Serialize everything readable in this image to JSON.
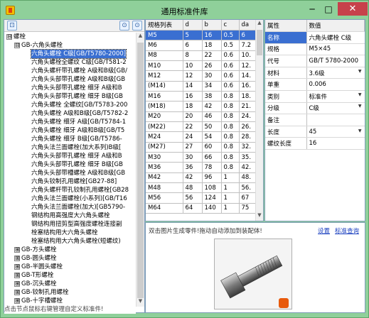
{
  "window": {
    "title": "通用标准件库",
    "minimize": "─",
    "maximize": "□",
    "close": "✕"
  },
  "left_toolbar": {
    "left_btn": "⊡",
    "search_btn": "⊙",
    "search2_btn": "⊙"
  },
  "tree": {
    "root": {
      "expander": "⊟",
      "label": "螺栓"
    },
    "group": {
      "expander": "⊟",
      "label": "GB-六角头螺栓"
    },
    "items": [
      "六角头螺栓 C级[GB/T5780-2000]",
      "六角头螺栓全螺纹 C级[GB/T581-2",
      "六角头螺杆带孔螺栓 A级和B级[GB/",
      "六角头头部带孔螺栓 A级和B级[GB",
      "六角头头部带孔螺栓 细牙 A级和B",
      "六角头头部带孔螺栓 细牙 B级[GB",
      "六角头螺栓 全螺纹[GB/T5783-200",
      "六角头螺栓 A级和B级[GB/T5782-2",
      "六角头螺栓 细牙 A级[GB/T5784-1",
      "六角头螺栓 细牙 A级和B级[GB/T5",
      "六角头螺栓 细牙 B级[GB/T5786-",
      "六角头法兰面螺栓(加大系列)B级[",
      "六角头头部带孔螺栓 细牙 A级和B",
      "六角头头部带孔螺栓 细牙 B级[GB",
      "六角头头部带槽螺栓 A级和B级[GB",
      "六角头铰制孔用螺栓[GB27-88]",
      "六角头螺杆带孔铰制孔用螺栓[GB28",
      "六角头法兰面螺栓(小系列)[GB/T16",
      "六角头法兰面螺栓(加大)[GB5790-",
      "钢结构用高强度大六角头螺栓",
      "钢结构用扭剪型高强度螺栓连接副",
      "栓塞结构用大六角头螺栓",
      "栓塞结构用大六角头螺栓(短螺纹)"
    ],
    "groups": [
      {
        "expander": "⊞",
        "label": "GB-方头螺栓"
      },
      {
        "expander": "⊞",
        "label": "GB-圆头螺栓"
      },
      {
        "expander": "⊞",
        "label": "GB-半圆头螺栓"
      },
      {
        "expander": "⊞",
        "label": "GB-T形螺栓"
      },
      {
        "expander": "⊞",
        "label": "GB-沉头螺栓"
      },
      {
        "expander": "⊞",
        "label": "GB-铰制孔用螺栓"
      },
      {
        "expander": "⊞",
        "label": "GB-十字槽螺栓"
      }
    ],
    "status": "点击节点鼠标右键管理自定义标准件!"
  },
  "spec_table": {
    "columns": [
      "规格列表",
      "d",
      "b",
      "c",
      "da"
    ],
    "rows": [
      [
        "M5",
        "5",
        "16",
        "0.5",
        "6"
      ],
      [
        "M6",
        "6",
        "18",
        "0.5",
        "7.2"
      ],
      [
        "M8",
        "8",
        "22",
        "0.6",
        "10."
      ],
      [
        "M10",
        "10",
        "26",
        "0.6",
        "12."
      ],
      [
        "M12",
        "12",
        "30",
        "0.6",
        "14."
      ],
      [
        "(M14)",
        "14",
        "34",
        "0.6",
        "16."
      ],
      [
        "M16",
        "16",
        "38",
        "0.8",
        "18."
      ],
      [
        "(M18)",
        "18",
        "42",
        "0.8",
        "21."
      ],
      [
        "M20",
        "20",
        "46",
        "0.8",
        "24."
      ],
      [
        "(M22)",
        "22",
        "50",
        "0.8",
        "26."
      ],
      [
        "M24",
        "24",
        "54",
        "0.8",
        "28."
      ],
      [
        "(M27)",
        "27",
        "60",
        "0.8",
        "32."
      ],
      [
        "M30",
        "30",
        "66",
        "0.8",
        "35."
      ],
      [
        "M36",
        "36",
        "78",
        "0.8",
        "42."
      ],
      [
        "M42",
        "42",
        "96",
        "1",
        "48."
      ],
      [
        "M48",
        "48",
        "108",
        "1",
        "56."
      ],
      [
        "M56",
        "56",
        "124",
        "1",
        "67"
      ],
      [
        "M64",
        "64",
        "140",
        "1",
        "75"
      ]
    ]
  },
  "props": {
    "header": [
      "属性",
      "数值"
    ],
    "rows": [
      {
        "key": "名称",
        "value": "六角头螺栓 C级",
        "dropdown": false
      },
      {
        "key": "规格",
        "value": "M5×45",
        "dropdown": false
      },
      {
        "key": "代号",
        "value": "GB/T 5780-2000",
        "dropdown": false
      },
      {
        "key": "材料",
        "value": "3.6级",
        "dropdown": true
      },
      {
        "key": "单重",
        "value": "0.006",
        "dropdown": false
      },
      {
        "key": "类别",
        "value": "标准件",
        "dropdown": true
      },
      {
        "key": "分级",
        "value": "C级",
        "dropdown": true
      },
      {
        "key": "备注",
        "value": "",
        "dropdown": false
      },
      {
        "key": "长度",
        "value": "45",
        "dropdown": true
      },
      {
        "key": "螺纹长度",
        "value": "16",
        "dropdown": false
      }
    ]
  },
  "preview": {
    "hint": "双击图片生成零件!拖动自动添加到装配体!",
    "settings_link": "设置",
    "query_link": "标准查询"
  },
  "colors": {
    "title_bar": "#8fd09a",
    "selection": "#3a6fd1",
    "close": "#c7414b"
  }
}
